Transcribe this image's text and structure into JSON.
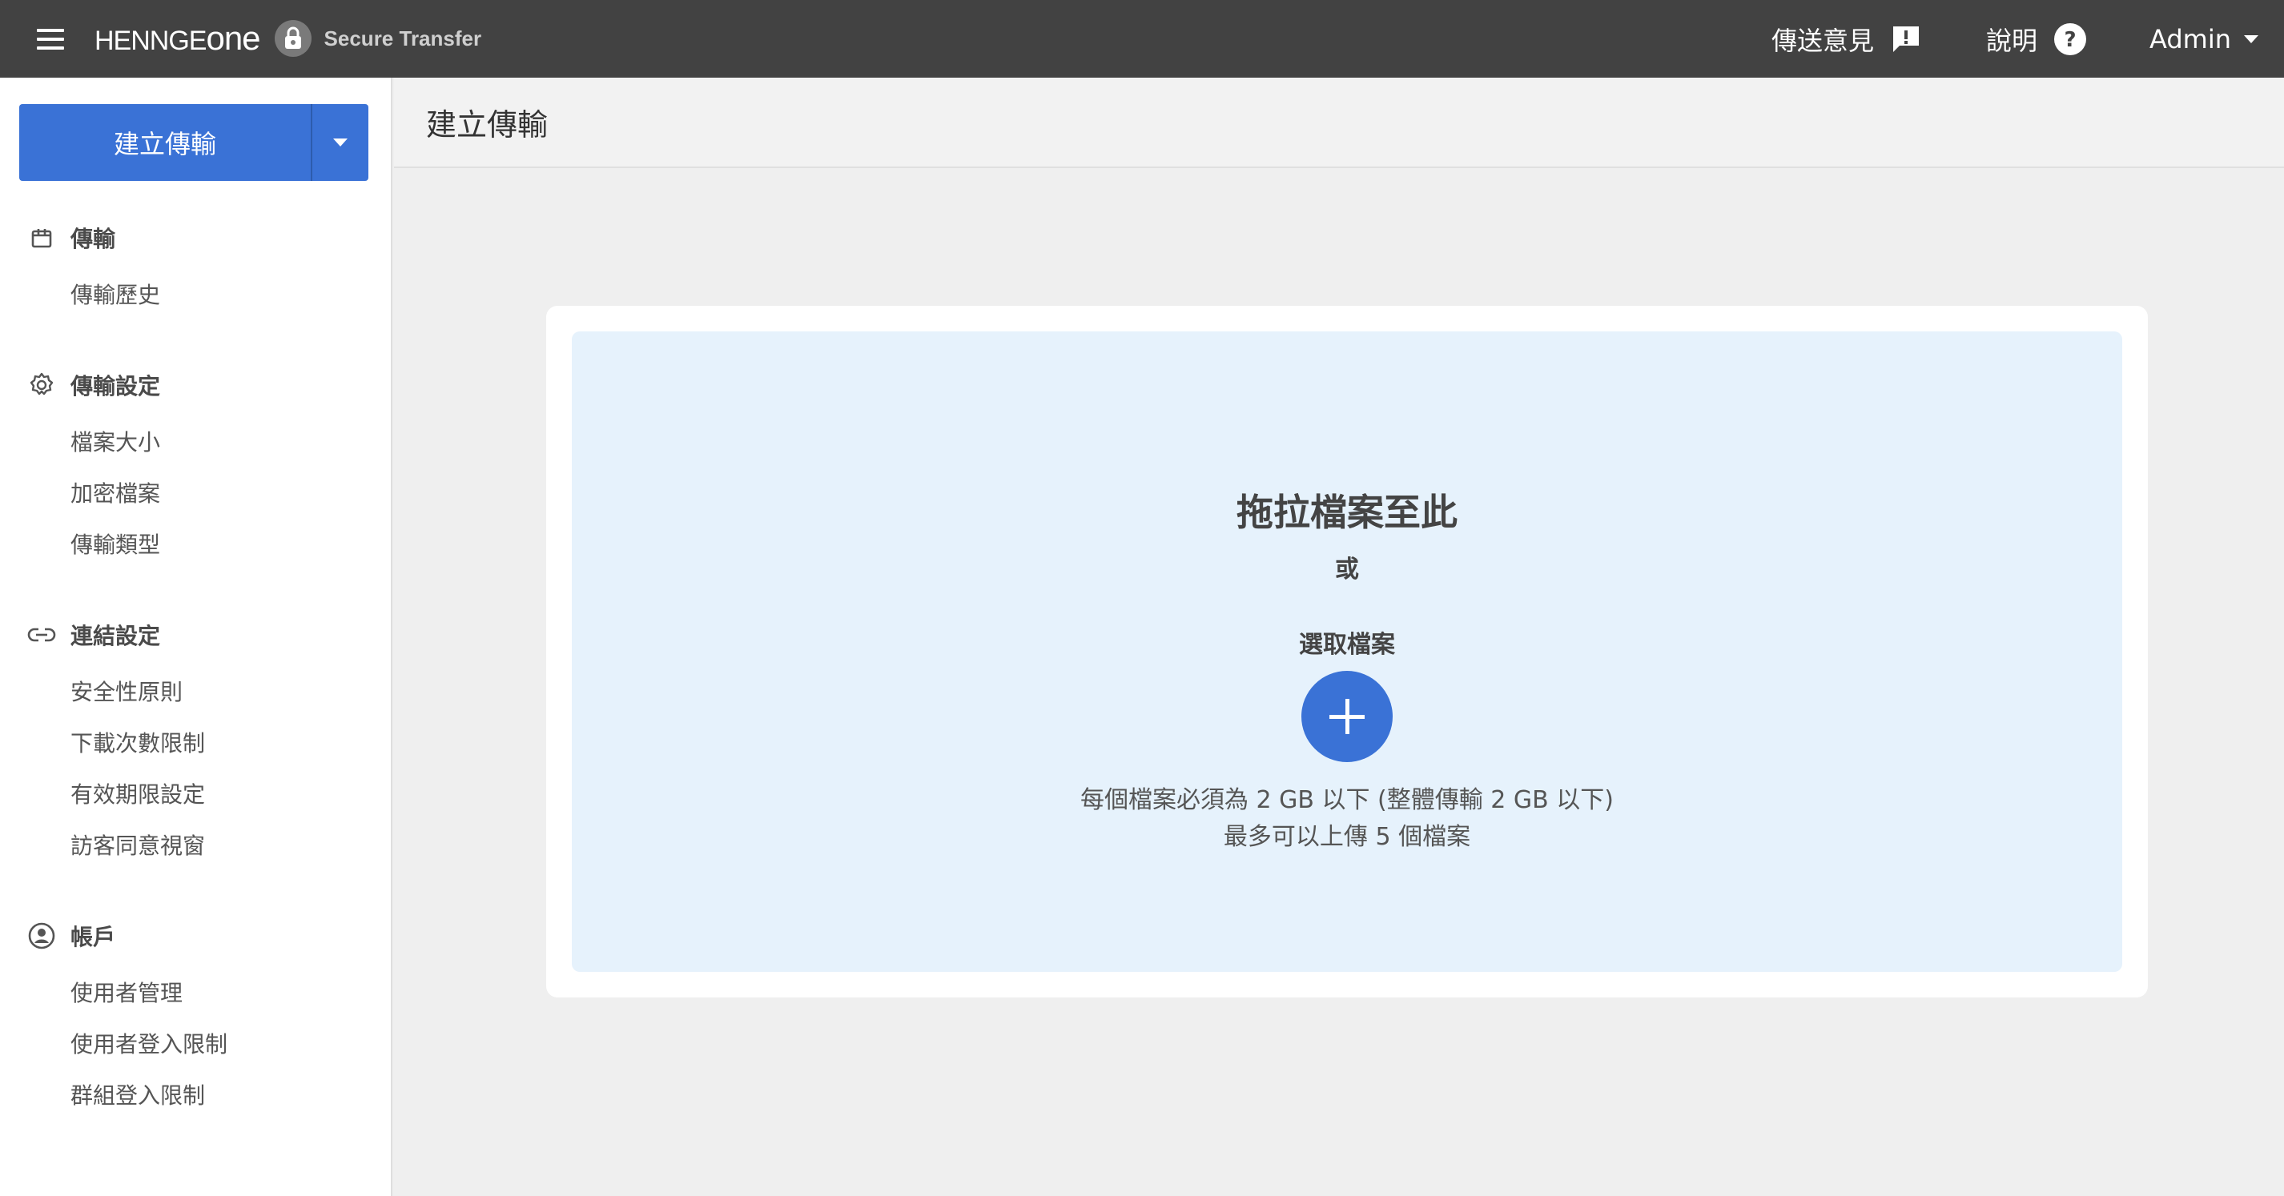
{
  "app": {
    "brand": "HENNGE",
    "brand_suffix": "one",
    "product": "Secure Transfer"
  },
  "topbar": {
    "feedback_label": "傳送意見",
    "help_label": "說明",
    "user_label": "Admin"
  },
  "sidebar": {
    "create_label": "建立傳輸",
    "sections": [
      {
        "heading": "傳輸",
        "icon": "box-icon",
        "items": [
          "傳輸歷史"
        ]
      },
      {
        "heading": "傳輸設定",
        "icon": "gear-icon",
        "items": [
          "檔案大小",
          "加密檔案",
          "傳輸類型"
        ]
      },
      {
        "heading": "連結設定",
        "icon": "link-icon",
        "items": [
          "安全性原則",
          "下載次數限制",
          "有效期限設定",
          "訪客同意視窗"
        ]
      },
      {
        "heading": "帳戶",
        "icon": "account-circle-icon",
        "items": [
          "使用者管理",
          "使用者登入限制",
          "群組登入限制"
        ]
      }
    ]
  },
  "main": {
    "title": "建立傳輸",
    "drop_title": "拖拉檔案至此",
    "or_label": "或",
    "select_label": "選取檔案",
    "size_note": "每個檔案必須為 2 GB 以下 (整體傳輸 2 GB 以下)",
    "count_note": "最多可以上傳 5 個檔案"
  },
  "colors": {
    "topbar": "#424242",
    "accent": "#3a72d6",
    "drop_zone": "#e6f2fc"
  }
}
